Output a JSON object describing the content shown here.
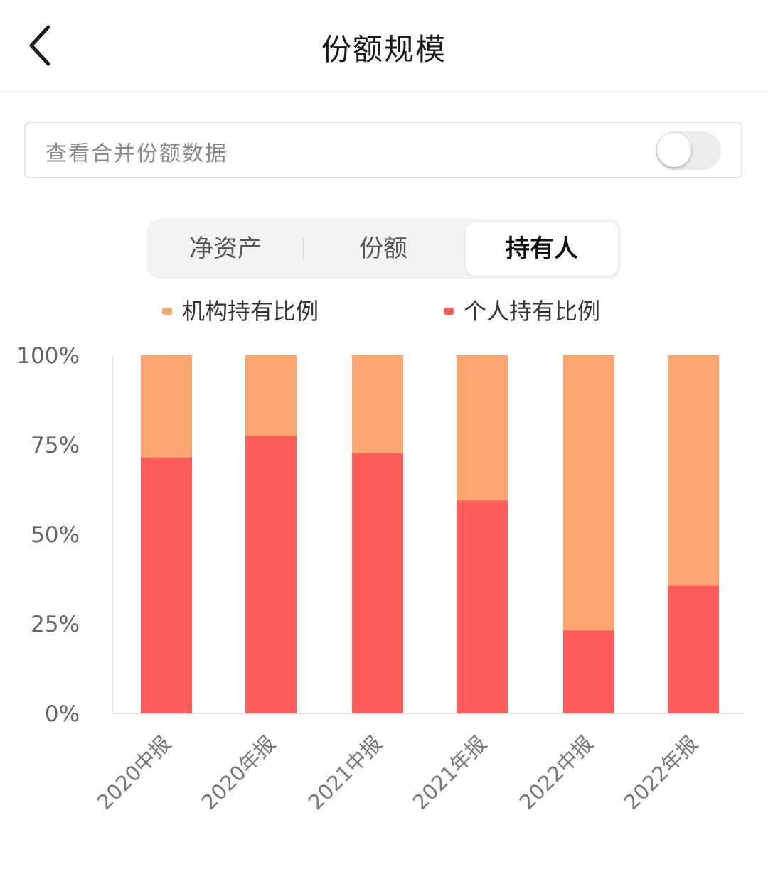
{
  "header": {
    "title": "份额规模",
    "back_icon": "chevron-left-icon"
  },
  "merge_toggle": {
    "label": "查看合并份额数据",
    "enabled": false
  },
  "tabs": [
    {
      "label": "净资产",
      "active": false
    },
    {
      "label": "份额",
      "active": false
    },
    {
      "label": "持有人",
      "active": true
    }
  ],
  "colors": {
    "institution": "#FCA66F",
    "individual": "#FF5C5C"
  },
  "chart_data": {
    "type": "bar",
    "stacked": true,
    "categories": [
      "2020中报",
      "2020年报",
      "2021中报",
      "2021年报",
      "2022中报",
      "2022年报"
    ],
    "series": [
      {
        "name": "个人持有比例",
        "values": [
          71.5,
          77.5,
          72.7,
          59.5,
          23.2,
          35.8
        ]
      },
      {
        "name": "机构持有比例",
        "values": [
          28.5,
          22.5,
          27.3,
          40.5,
          76.8,
          64.2
        ]
      }
    ],
    "legend": [
      "机构持有比例",
      "个人持有比例"
    ],
    "legend_position": "top",
    "y_ticks": [
      "0%",
      "25%",
      "50%",
      "75%",
      "100%"
    ],
    "ylim": [
      0,
      100
    ],
    "x_labels_rotated": true
  }
}
